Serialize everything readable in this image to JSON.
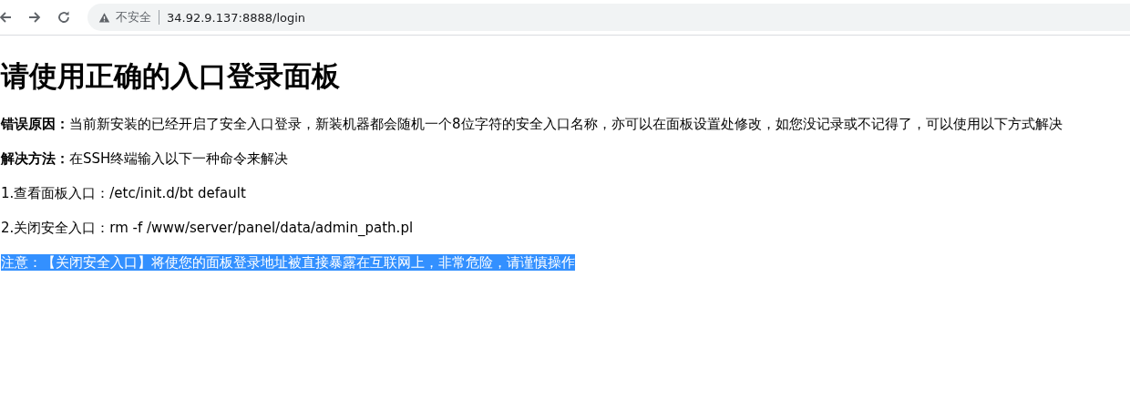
{
  "browser": {
    "security_label": "不安全",
    "address": "34.92.9.137:8888/login"
  },
  "page": {
    "title": "请使用正确的入口登录面板",
    "paragraphs": [
      {
        "text": "**错误原因：**当前新安装的已经开启了安全入口登录，新装机器都会随机一个8位字符的安全入口名称，亦可以在面板设置处修改，如您没记录或不记得了，可以使用以下方式解决",
        "selected": false
      },
      {
        "text": "**解决方法：**在SSH终端输入以下一种命令来解决",
        "selected": false
      },
      {
        "text": "1.查看面板入口：/etc/init.d/bt default",
        "selected": false
      },
      {
        "text": "2.关闭安全入口：rm -f /www/server/panel/data/admin_path.pl",
        "selected": false
      },
      {
        "text": "注意：【关闭安全入口】将使您的面板登录地址被直接暴露在互联网上，非常危险，请谨慎操作",
        "selected": true
      }
    ]
  }
}
